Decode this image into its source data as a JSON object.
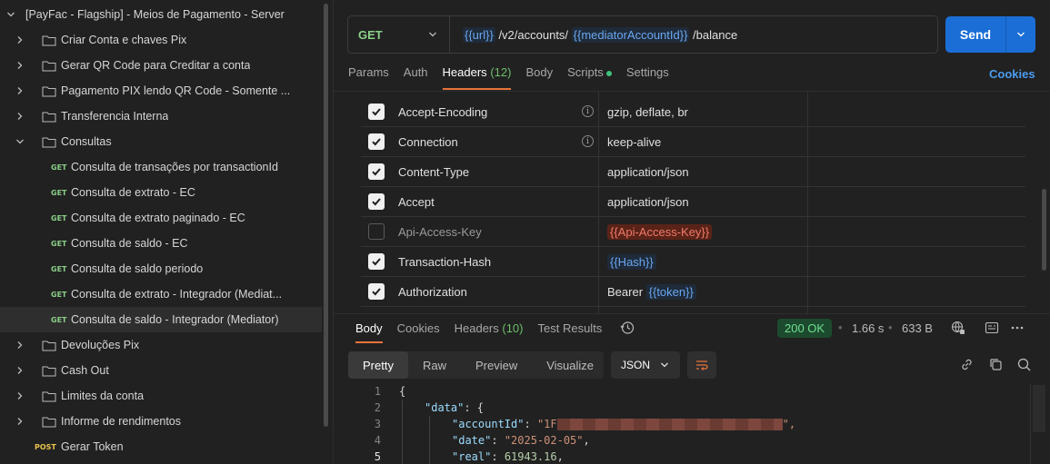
{
  "sidebar": {
    "collection": "[PayFac - Flagship] - Meios de Pagamento - Server",
    "items": [
      {
        "type": "folder",
        "label": "Criar Conta e chaves Pix",
        "expanded": false
      },
      {
        "type": "folder",
        "label": "Gerar QR Code para Creditar a conta",
        "expanded": false
      },
      {
        "type": "folder",
        "label": "Pagamento PIX lendo QR Code - Somente ...",
        "expanded": false
      },
      {
        "type": "folder",
        "label": "Transferencia Interna",
        "expanded": false
      },
      {
        "type": "folder",
        "label": "Consultas",
        "expanded": true
      }
    ],
    "requests": [
      {
        "method": "GET",
        "label": "Consulta de transações por transactionId"
      },
      {
        "method": "GET",
        "label": "Consulta de extrato - EC"
      },
      {
        "method": "GET",
        "label": "Consulta de extrato paginado - EC"
      },
      {
        "method": "GET",
        "label": "Consulta de saldo - EC"
      },
      {
        "method": "GET",
        "label": "Consulta de saldo periodo"
      },
      {
        "method": "GET",
        "label": "Consulta de extrato - Integrador (Mediat..."
      },
      {
        "method": "GET",
        "label": "Consulta de saldo - Integrador (Mediator)"
      }
    ],
    "folders_after": [
      {
        "label": "Devoluções Pix"
      },
      {
        "label": "Cash Out"
      },
      {
        "label": "Limites da conta"
      },
      {
        "label": "Informe de rendimentos"
      }
    ],
    "post_request": {
      "method": "POST",
      "label": "Gerar Token"
    }
  },
  "request": {
    "method": "GET",
    "url_var1": "{{url}}",
    "url_part1": " /v2/accounts/ ",
    "url_var2": "{{mediatorAccountId}}",
    "url_part2": " /balance",
    "send_label": "Send"
  },
  "req_tabs": {
    "params": "Params",
    "auth": "Auth",
    "headers": "Headers",
    "headers_count": "(12)",
    "body": "Body",
    "scripts": "Scripts",
    "settings": "Settings",
    "cookies": "Cookies"
  },
  "headers": [
    {
      "checked": true,
      "key": "Accept-Encoding",
      "info": true,
      "value": "gzip, deflate, br"
    },
    {
      "checked": true,
      "key": "Connection",
      "info": true,
      "value": "keep-alive"
    },
    {
      "checked": true,
      "key": "Content-Type",
      "info": false,
      "value": "application/json"
    },
    {
      "checked": true,
      "key": "Accept",
      "info": false,
      "value": "application/json"
    },
    {
      "checked": false,
      "key": "Api-Access-Key",
      "info": false,
      "value_var_red": "{{Api-Access-Key}}"
    },
    {
      "checked": true,
      "key": "Transaction-Hash",
      "info": false,
      "value_var": "{{Hash}}"
    },
    {
      "checked": true,
      "key": "Authorization",
      "info": false,
      "value_prefix": "Bearer ",
      "value_var": "{{token}}"
    }
  ],
  "response": {
    "tabs": {
      "body": "Body",
      "cookies": "Cookies",
      "headers": "Headers",
      "headers_count": "(10)",
      "tests": "Test Results"
    },
    "status": "200 OK",
    "time": "1.66 s",
    "size": "633 B",
    "view_tabs": {
      "pretty": "Pretty",
      "raw": "Raw",
      "preview": "Preview",
      "visualize": "Visualize"
    },
    "format": "JSON",
    "code": {
      "l1": "{",
      "l2_key": "\"data\"",
      "l2_rest": ": {",
      "l3_key": "\"accountId\"",
      "l3_str": "\"1F",
      "l3_end": "\",",
      "l4_key": "\"date\"",
      "l4_str": "\"2025-02-05\"",
      "l5_key": "\"real\"",
      "l5_num": "61943.16"
    },
    "line_numbers": [
      "1",
      "2",
      "3",
      "4",
      "5"
    ]
  },
  "colors": {
    "accent": "#e8743b",
    "send": "#1a6ed6",
    "get": "#8bcf88",
    "post": "#e8c34d"
  }
}
